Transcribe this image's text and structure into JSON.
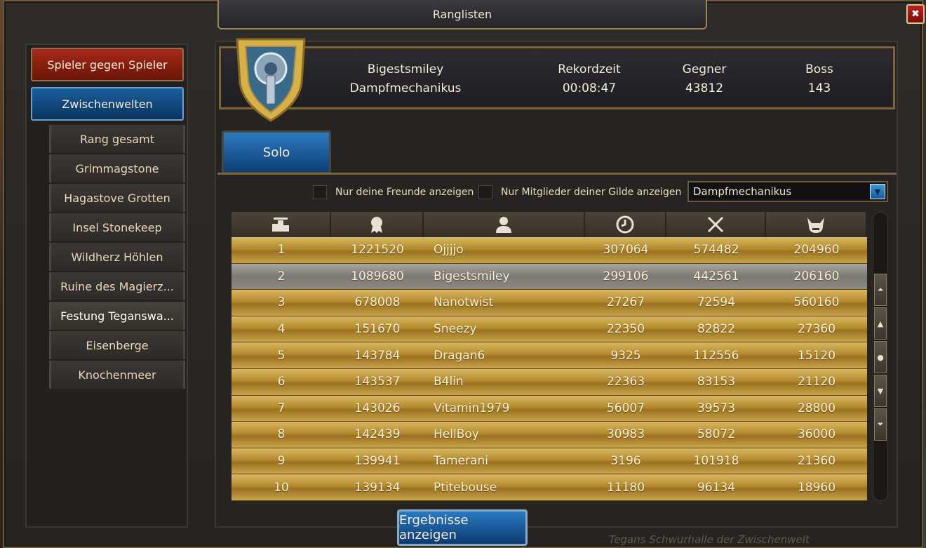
{
  "window": {
    "title": "Ranglisten",
    "close_label": "✖"
  },
  "sidebar": {
    "categories": [
      {
        "label": "Spieler gegen Spieler"
      },
      {
        "label": "Zwischenwelten"
      }
    ],
    "items": [
      {
        "label": "Rang gesamt"
      },
      {
        "label": "Grimmagstone"
      },
      {
        "label": "Hagastove Grotten"
      },
      {
        "label": "Insel Stonekeep"
      },
      {
        "label": "Wildherz Höhlen"
      },
      {
        "label": "Ruine des Magierz..."
      },
      {
        "label": "Festung Teganswa..."
      },
      {
        "label": "Eisenberge"
      },
      {
        "label": "Knochenmeer"
      }
    ]
  },
  "header": {
    "player_line1": "Bigestsmiley",
    "player_line2": "Dampfmechanikus",
    "record_label": "Rekordzeit",
    "record_value": "00:08:47",
    "enemies_label": "Gegner",
    "enemies_value": "43812",
    "boss_label": "Boss",
    "boss_value": "143"
  },
  "tabs": {
    "solo": "Solo"
  },
  "filters": {
    "friends_label": "Nur deine Freunde anzeigen",
    "guild_label": "Nur Mitglieder deiner Gilde anzeigen",
    "dropdown_value": "Dampfmechanikus"
  },
  "table": {
    "header_icons": [
      "rank-icon",
      "score-icon",
      "player-icon",
      "time-icon",
      "swords-icon",
      "boss-icon"
    ],
    "rows": [
      {
        "rank": "1",
        "score": "1221520",
        "name": "Ojjjjo",
        "time": "307064",
        "enemies": "574482",
        "boss": "204960"
      },
      {
        "rank": "2",
        "score": "1089680",
        "name": "Bigestsmiley",
        "time": "299106",
        "enemies": "442561",
        "boss": "206160"
      },
      {
        "rank": "3",
        "score": "678008",
        "name": "Nanotwist",
        "time": "27267",
        "enemies": "72594",
        "boss": "560160"
      },
      {
        "rank": "4",
        "score": "151670",
        "name": "Sneezy",
        "time": "22350",
        "enemies": "82822",
        "boss": "27360"
      },
      {
        "rank": "5",
        "score": "143784",
        "name": "Dragan6",
        "time": "9325",
        "enemies": "112556",
        "boss": "15120"
      },
      {
        "rank": "6",
        "score": "143537",
        "name": "B4lin",
        "time": "22363",
        "enemies": "83153",
        "boss": "21120"
      },
      {
        "rank": "7",
        "score": "143026",
        "name": "Vitamin1979",
        "time": "56007",
        "enemies": "39573",
        "boss": "28800"
      },
      {
        "rank": "8",
        "score": "142439",
        "name": "HellBoy",
        "time": "30983",
        "enemies": "58072",
        "boss": "36000"
      },
      {
        "rank": "9",
        "score": "139941",
        "name": "Tamerani",
        "time": "3196",
        "enemies": "101918",
        "boss": "21360"
      },
      {
        "rank": "10",
        "score": "139134",
        "name": "Ptitebouse",
        "time": "11180",
        "enemies": "96134",
        "boss": "18960"
      }
    ]
  },
  "results_button": "Ergebnisse anzeigen",
  "location": "Tegans Schwurhalle der Zwischenwelt",
  "colors": {
    "accent_blue": "#1a5e9a",
    "pvp_red": "#a82a18",
    "row_gold": "#c8a44a",
    "row_highlight": "#8c8884"
  }
}
